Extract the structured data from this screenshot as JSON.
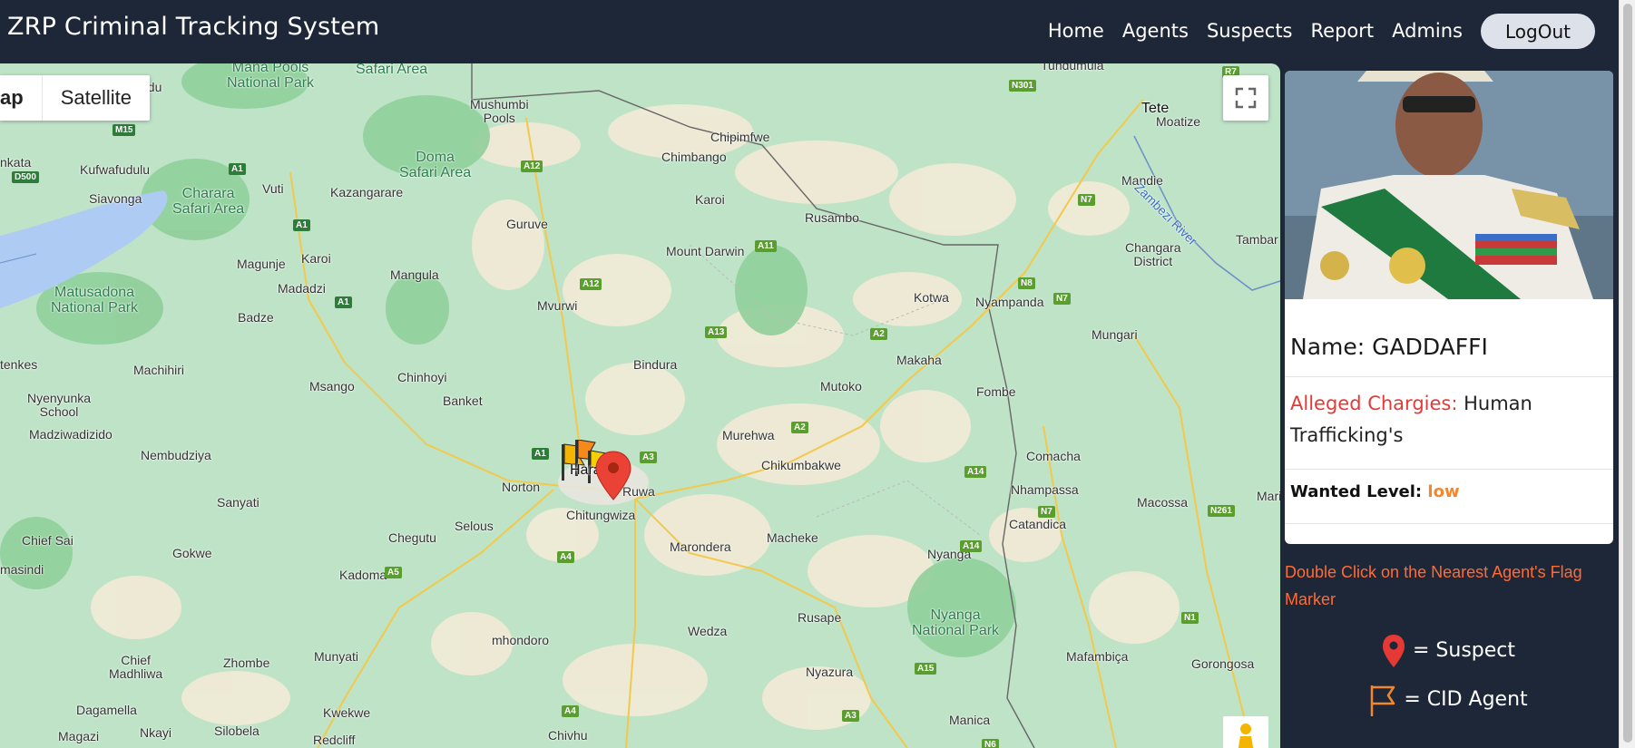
{
  "app_title": "ZRP Criminal Tracking System",
  "nav": {
    "links": [
      {
        "label": "Home"
      },
      {
        "label": "Agents"
      },
      {
        "label": "Suspects"
      },
      {
        "label": "Report"
      },
      {
        "label": "Admins"
      }
    ],
    "logout_label": "LogOut"
  },
  "map": {
    "type_options": [
      "ap",
      "Satellite"
    ],
    "selected_type": "Map",
    "labels": {
      "mana_pools": "Mana Pools\nNational Park",
      "safari_area_top": "Safari Area",
      "tundumula": "Tundumula",
      "ndu": "ndu",
      "mushumbi": "Mushumbi\nPools",
      "chipimfwe": "Chipimfwe",
      "tete": "Tete",
      "moatize": "Moatize",
      "kufwafudulu": "Kufwafudulu",
      "doma": "Doma\nSafari Area",
      "chimbango": "Chimbango",
      "siavonga": "Siavonga",
      "vuti": "Vuti",
      "kazangarare": "Kazangarare",
      "charara": "Charara\nSafari Area",
      "karoi_n": "Karoi",
      "rusambo": "Rusambo",
      "mandie": "Mandie",
      "zambezi": "Zambezi River",
      "nkata": "nkata",
      "guruve": "Guruve",
      "tambar": "Tambar",
      "magunje": "Magunje",
      "karoi": "Karoi",
      "mount_darwin": "Mount Darwin",
      "changara": "Changara\nDistrict",
      "madadzi": "Madadzi",
      "mangula": "Mangula",
      "matusadona": "Matusadona\nNational Park",
      "badze": "Badze",
      "mvurwi": "Mvurwi",
      "kotwa": "Kotwa",
      "nyampanda": "Nyampanda",
      "mungari": "Mungari",
      "makaha": "Makaha",
      "tenkes": "tenkes",
      "machihiri": "Machihiri",
      "bindura": "Bindura",
      "chinhoyi": "Chinhoyi",
      "nyenyunka": "Nyenyunka\nSchool",
      "msango": "Msango",
      "banket": "Banket",
      "mutoko": "Mutoko",
      "fombe": "Fombe",
      "madziwadizido": "Madziwadizido",
      "murehwa": "Murehwa",
      "nembudziya": "Nembudziya",
      "chikumbakwe": "Chikumbakwe",
      "comacha": "Comacha",
      "harare": "Harare",
      "norton": "Norton",
      "ruwa": "Ruwa",
      "nhampassa": "Nhampassa",
      "sanyati": "Sanyati",
      "macossa": "Macossa",
      "mari": "Mari",
      "chitungwiza": "Chitungwiza",
      "selous": "Selous",
      "catandica": "Catandica",
      "chief_sai": "Chief Sai",
      "chegutu": "Chegutu",
      "macheke": "Macheke",
      "marondera": "Marondera",
      "gokwe": "Gokwe",
      "nyanga": "Nyanga",
      "masindi": "masindi",
      "kadoma": "Kadoma",
      "nyanga_np": "Nyanga\nNational Park",
      "wedza": "Wedza",
      "mhondoro": "mhondoro",
      "rusape": "Rusape",
      "munyati": "Munyati",
      "zhombe": "Zhombe",
      "chief_madhliwa": "Chief\nMadhliwa",
      "nyazura": "Nyazura",
      "mafambica": "Mafambiça",
      "gorongosa": "Gorongosa",
      "dagamella": "Dagamella",
      "kwekwe": "Kwekwe",
      "manica": "Manica",
      "magazi": "Magazi",
      "nkayi": "Nkayi",
      "silobela": "Silobela",
      "redcliff": "Redcliff",
      "chivhu": "Chivhu"
    },
    "route_shields": [
      "M15",
      "A1",
      "D500",
      "A1",
      "A12",
      "A1",
      "A11",
      "A12",
      "N7",
      "N8",
      "N7",
      "A13",
      "A2",
      "A2",
      "A1",
      "A3",
      "N7",
      "A14",
      "N261",
      "A4",
      "A5",
      "A14",
      "N1",
      "A15",
      "A3",
      "A4",
      "N6",
      "N301",
      "R7"
    ]
  },
  "suspect": {
    "name_label": "Name:",
    "name": "GADDAFFI",
    "charges_label": "Alleged Chargies:",
    "charges": "Human Trafficking's",
    "wanted_label": "Wanted Level:",
    "wanted_level": "low"
  },
  "hint": "Double Click on the Nearest Agent's Flag Marker",
  "legend": {
    "suspect": "= Suspect",
    "agent": "= CID Agent"
  },
  "colors": {
    "navbar_bg": "#1e2738",
    "map_green": "#bfe3c7",
    "charge_label": "#e53935",
    "wanted_value": "#f4862c",
    "hint_text": "#ff6b35"
  }
}
